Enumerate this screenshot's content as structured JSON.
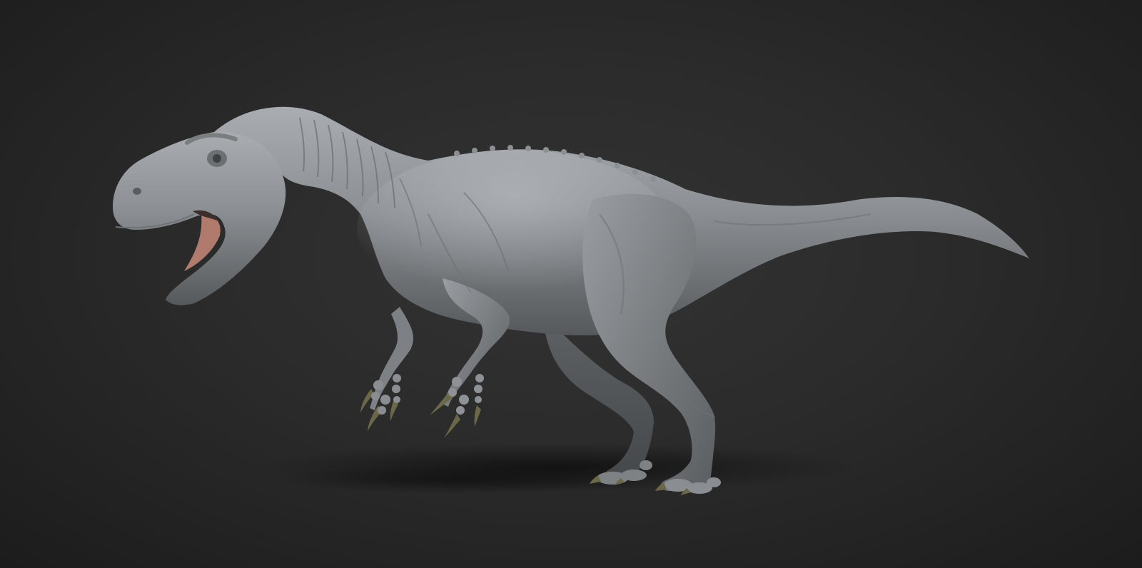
{
  "scene": {
    "subject": "dinosaur-sculpt",
    "subject_label": "",
    "colors": {
      "background_center": "#333333",
      "background_edge": "#1c1c1c",
      "clay": "#8a8e92",
      "clay_highlight": "#b4b8bc",
      "clay_shadow": "#4d5154",
      "mouth": "#b07a6c",
      "claws": "#6a6848",
      "ground_shadow": "#141414"
    }
  }
}
